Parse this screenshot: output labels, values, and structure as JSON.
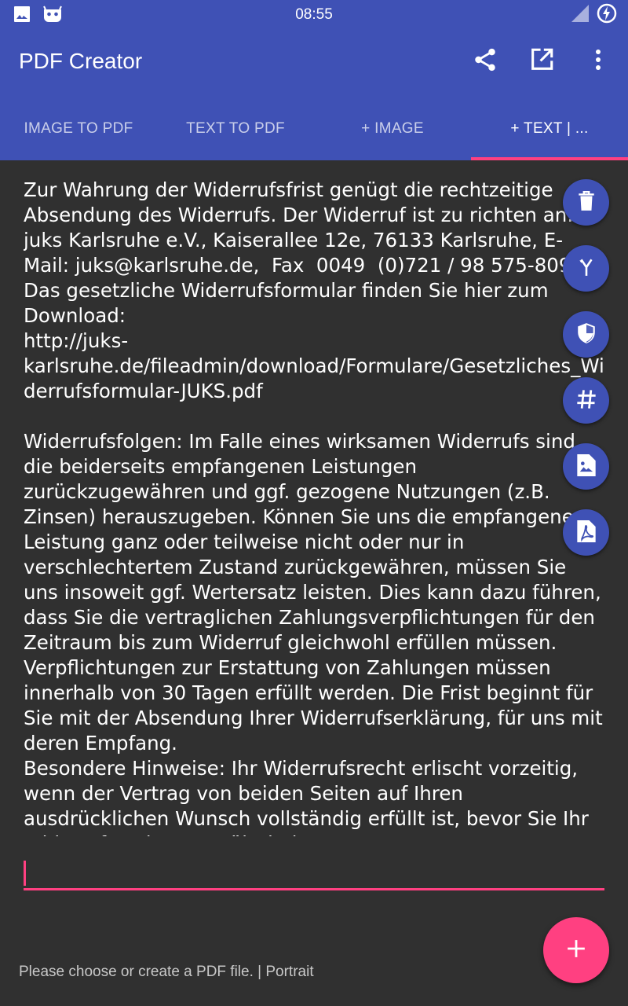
{
  "status_bar": {
    "time": "08:55",
    "left_icons": [
      "image-icon",
      "android-debug-icon"
    ],
    "right_icons": [
      "signal-icon",
      "battery-charging-icon"
    ]
  },
  "app_bar": {
    "title": "PDF Creator",
    "actions": [
      "share-icon",
      "open-external-icon",
      "more-vert-icon"
    ]
  },
  "tabs": [
    {
      "label": "IMAGE TO PDF",
      "active": false
    },
    {
      "label": "TEXT TO PDF",
      "active": false
    },
    {
      "label": "+ IMAGE",
      "active": false
    },
    {
      "label": "+ TEXT | ...",
      "active": true
    }
  ],
  "editor": {
    "text": "Zur Wahrung der Widerrufsfrist genügt die rechtzeitige Absendung des Widerrufs. Der Widerruf ist zu richten an: juks Karlsruhe e.V., Kaiserallee 12e, 76133 Karlsruhe, E-Mail: juks@karlsruhe.de,  Fax  0049  (0)721 / 98 575-809\nDas gesetzliche Widerrufsformular finden Sie hier zum Download:\nhttp://juks-karlsruhe.de/fileadmin/download/Formulare/Gesetzliches_Widerrufsformular-JUKS.pdf\n\nWiderrufsfolgen: Im Falle eines wirksamen Widerrufs sind die beiderseits empfangenen Leistungen zurückzugewähren und ggf. gezogene Nutzungen (z.B. Zinsen) herauszugeben. Können Sie uns die empfangene Leistung ganz oder teilweise nicht oder nur in verschlechtertem Zustand zurückgewähren, müssen Sie uns insoweit ggf. Wertersatz leisten. Dies kann dazu führen, dass Sie die vertraglichen Zahlungsverpflichtungen für den Zeitraum bis zum Widerruf gleichwohl erfüllen müssen. Verpflichtungen zur Erstattung von Zahlungen müssen innerhalb von 30 Tagen erfüllt werden. Die Frist beginnt für Sie mit der Absendung Ihrer Widerrufserklärung, für uns mit deren Empfang.\nBesondere Hinweise: Ihr Widerrufsrecht erlischt vorzeitig, wenn der Vertrag von beiden Seiten auf Ihren ausdrücklichen Wunsch vollständig erfüllt ist, bevor Sie Ihr Widerrufsrecht ausgeübt haben."
  },
  "mini_fabs": [
    "delete-icon",
    "merge-icon",
    "shield-icon",
    "hash-icon",
    "image-file-icon",
    "pdf-file-icon"
  ],
  "main_fab": "add-icon",
  "footer": {
    "status": "Please choose or create a PDF file. | Portrait"
  },
  "colors": {
    "primary": "#3f51b5",
    "accent": "#ff4081",
    "background": "#303030"
  }
}
